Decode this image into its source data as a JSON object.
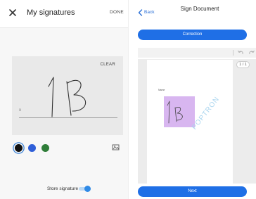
{
  "left_panel": {
    "title": "My signatures",
    "done_label": "DONE",
    "clear_label": "CLEAR",
    "sign_marker": "x",
    "signature_text": "1B",
    "ink_colors": [
      "#111111",
      "#2f5fd8",
      "#2f7d39"
    ],
    "selected_color": "#111111",
    "store_signature_label": "Store signature",
    "store_signature_on": true
  },
  "right_panel": {
    "back_label": "Back",
    "title": "Sign Document",
    "correction_label": "Correction",
    "page_indicator": "1 / 1",
    "document_label": "Name ",
    "watermark_text": "POPTRON",
    "next_label": "Next",
    "signature_highlight_color": "#d8b6f0",
    "accent_color": "#1f6fe6"
  }
}
